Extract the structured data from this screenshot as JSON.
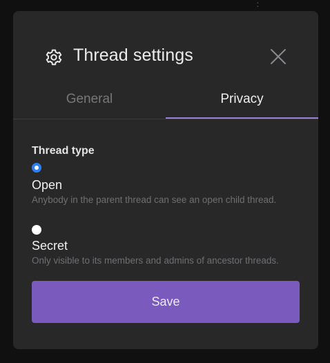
{
  "dialog": {
    "title": "Thread settings",
    "icon": "gear-icon",
    "close_icon": "close-icon"
  },
  "tabs": [
    {
      "label": "General",
      "active": false
    },
    {
      "label": "Privacy",
      "active": true
    }
  ],
  "thread_type": {
    "label": "Thread type",
    "options": [
      {
        "title": "Open",
        "description": "Anybody in the parent thread can see an open child thread.",
        "selected": true
      },
      {
        "title": "Secret",
        "description": "Only visible to its members and admins of ancestor threads.",
        "selected": false
      }
    ]
  },
  "actions": {
    "save_label": "Save"
  },
  "colors": {
    "accent": "#7a5bbd",
    "tab_indicator": "#9a7fd6",
    "radio_selected": "#2f7ef2",
    "modal_bg": "#282829"
  }
}
